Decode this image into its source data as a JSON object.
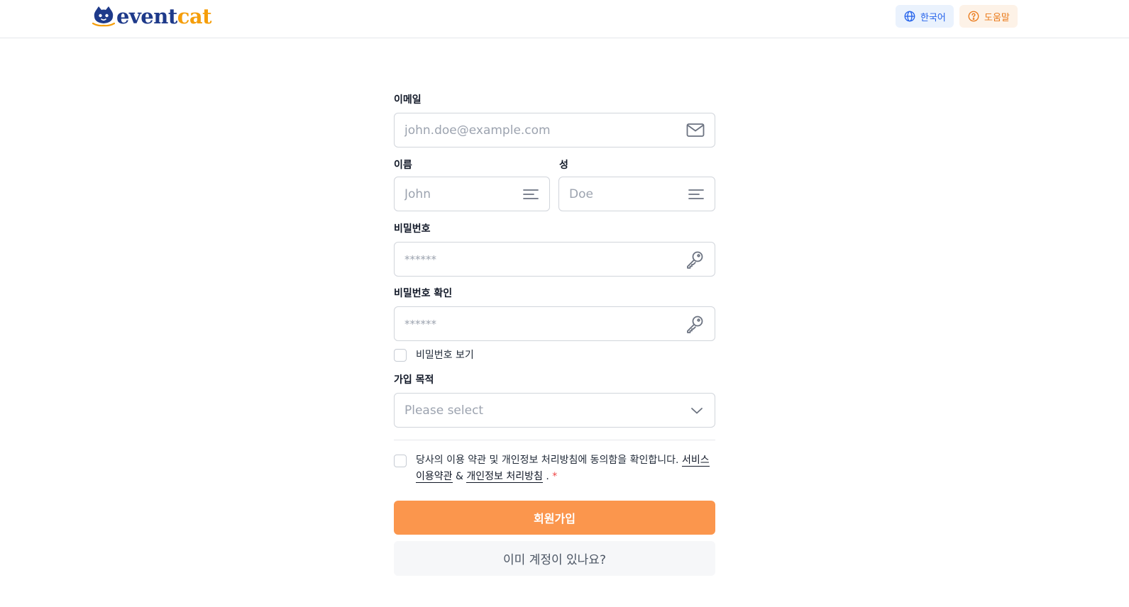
{
  "header": {
    "logo": {
      "part1": "event",
      "part2": "cat",
      "icon": "cat-logo-icon"
    },
    "language_label": "한국어",
    "help_label": "도움말",
    "colors": {
      "language_bg": "#eaf2fd",
      "language_fg": "#2563eb",
      "help_bg": "#fdf2e7",
      "help_fg": "#ea7a1a"
    }
  },
  "form": {
    "email": {
      "label": "이메일",
      "placeholder": "john.doe@example.com",
      "icon": "mail-icon"
    },
    "first_name": {
      "label": "이름",
      "placeholder": "John",
      "icon": "text-lines-icon"
    },
    "last_name": {
      "label": "성",
      "placeholder": "Doe",
      "icon": "text-lines-icon"
    },
    "password": {
      "label": "비밀번호",
      "placeholder": "******",
      "icon": "key-icon"
    },
    "password_confirm": {
      "label": "비밀번호 확인",
      "placeholder": "******",
      "icon": "key-icon"
    },
    "show_password": {
      "label": "비밀번호 보기",
      "checked": false
    },
    "purpose": {
      "label": "가입 목적",
      "placeholder": "Please select",
      "icon": "chevron-down-icon"
    },
    "terms": {
      "checked": false,
      "text": "당사의 이용 약관 및 개인정보 처리방침에 동의함을 확인합니다.",
      "link1": "서비스 이용약관",
      "amp": "&",
      "link2": "개인정보 처리방침",
      "period": ".",
      "required_mark": "*"
    },
    "submit_label": "회원가입",
    "login_label": "이미 계정이 있나요?",
    "colors": {
      "primary": "#fb964d",
      "secondary_bg": "#f6f7f9",
      "required": "#ef4444"
    }
  }
}
